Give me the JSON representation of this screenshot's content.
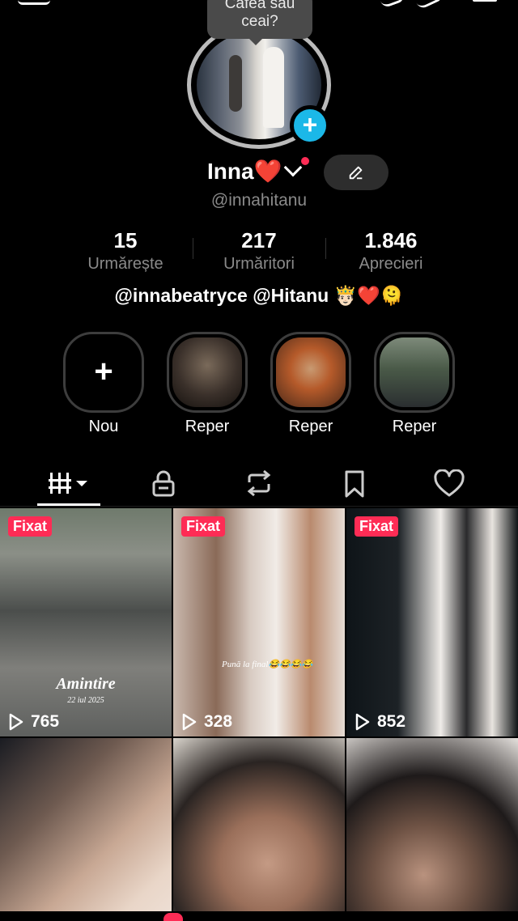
{
  "profile": {
    "story_bubble": "Cafea sau ceai?",
    "name": "Inna❤️",
    "handle": "@innahitanu",
    "bio": "@innabeatryce @Hitanu 🤴🏻❤️🫠"
  },
  "stats": [
    {
      "value": "15",
      "label": "Urmărește"
    },
    {
      "value": "217",
      "label": "Urmăritori"
    },
    {
      "value": "1.846",
      "label": "Aprecieri"
    }
  ],
  "highlights": [
    {
      "label": "Nou"
    },
    {
      "label": "Reper"
    },
    {
      "label": "Reper"
    },
    {
      "label": "Reper"
    }
  ],
  "tabs": [
    "videos-grid-icon",
    "lock-icon",
    "repost-icon",
    "bookmark-icon",
    "heart-icon"
  ],
  "videos": [
    {
      "pinned": "Fixat",
      "views": "765",
      "caption": "Amintire",
      "caption_date": "22 iul 2025"
    },
    {
      "pinned": "Fixat",
      "views": "328",
      "caption": "Pună la final😂😂😂😂"
    },
    {
      "pinned": "Fixat",
      "views": "852"
    },
    {},
    {},
    {}
  ],
  "colors": {
    "accent": "#fe2c55",
    "plus": "#1bb8e8",
    "background": "#000000"
  }
}
